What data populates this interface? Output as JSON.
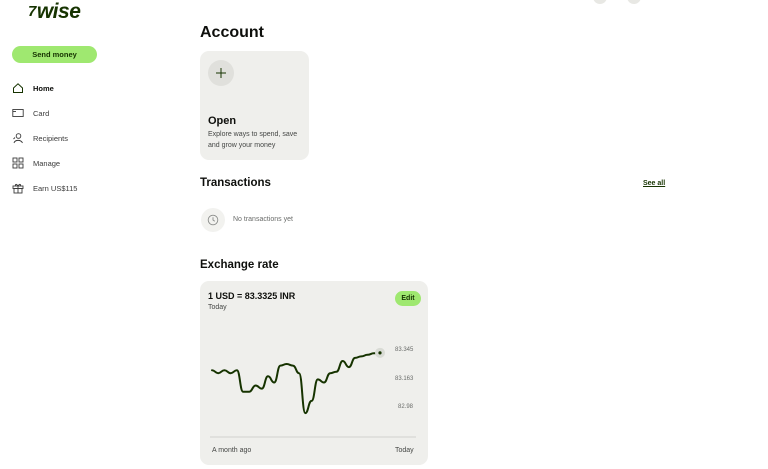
{
  "brand": {
    "logo_text": "wise",
    "logo_mark": "7"
  },
  "sidebar": {
    "send_button": "Send money",
    "items": [
      {
        "label": "Home",
        "icon": "home-icon",
        "active": true
      },
      {
        "label": "Card",
        "icon": "card-icon",
        "active": false
      },
      {
        "label": "Recipients",
        "icon": "recipients-icon",
        "active": false
      },
      {
        "label": "Manage",
        "icon": "manage-icon",
        "active": false
      },
      {
        "label": "Earn US$115",
        "icon": "gift-icon",
        "active": false
      }
    ]
  },
  "account": {
    "title": "Account",
    "open_card": {
      "title": "Open",
      "description": "Explore ways to spend, save and grow your money"
    }
  },
  "transactions": {
    "title": "Transactions",
    "see_all": "See all",
    "empty_text": "No transactions yet"
  },
  "exchange_rate": {
    "title": "Exchange rate",
    "rate": "1 USD = 83.3325 INR",
    "period": "Today",
    "edit_label": "Edit",
    "x_start_label": "A month ago",
    "x_end_label": "Today",
    "y_ticks": [
      "83.345",
      "83.163",
      "82.98"
    ]
  },
  "chart_data": {
    "type": "line",
    "ylim": [
      82.98,
      83.345
    ],
    "series": [
      {
        "values": [
          83.22,
          83.2,
          83.22,
          83.2,
          83.22,
          83.08,
          83.08,
          83.12,
          83.1,
          83.18,
          83.14,
          83.25,
          83.26,
          83.25,
          83.2,
          82.94,
          83.02,
          83.16,
          83.14,
          83.2,
          83.21,
          83.28,
          83.24,
          83.3,
          83.31,
          83.32,
          83.33,
          83.333
        ]
      }
    ],
    "colors": {
      "line": "#163300",
      "accent": "#9fe870"
    }
  }
}
